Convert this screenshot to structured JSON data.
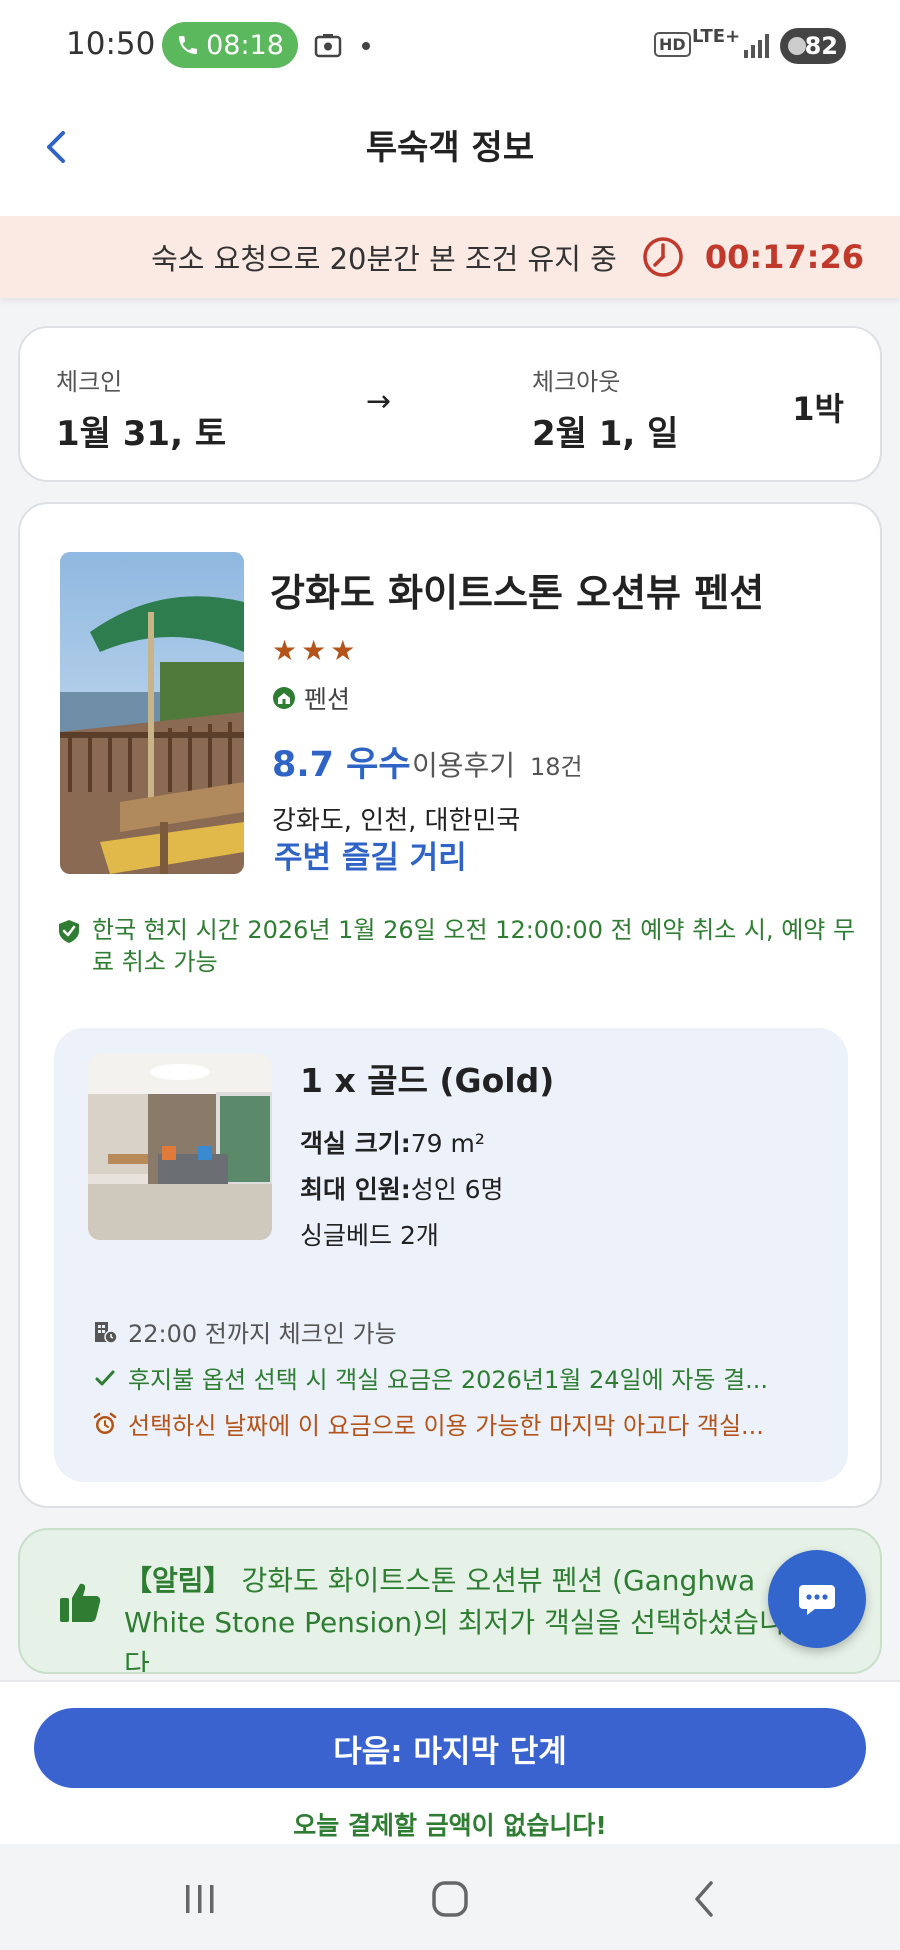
{
  "status_bar": {
    "time": "10:50",
    "call_duration": "08:18",
    "network_hd": "HD",
    "network_type": "LTE+",
    "battery": "82"
  },
  "header": {
    "title": "투숙객 정보"
  },
  "timer_banner": {
    "message": "숙소 요청으로 20분간 본 조건 유지 중",
    "countdown": "00:17:26",
    "color": "#c0392b"
  },
  "dates": {
    "checkin_label": "체크인",
    "checkin_value": "1월 31, 토",
    "checkout_label": "체크아웃",
    "checkout_value": "2월 1, 일",
    "arrow": "→",
    "nights": "1박"
  },
  "hotel": {
    "name": "강화도 화이트스톤 오션뷰 펜션",
    "stars": "★★★",
    "type": "펜션",
    "rating": "8.7 우수",
    "reviews_label": "이용후기",
    "reviews_count": "18건",
    "location": "강화도, 인천, 대한민국",
    "nearby_link": "주변 즐길 거리",
    "cancellation": "한국 현지 시간 2026년 1월 26일 오전 12:00:00 전 예약 취소 시, 예약 무료 취소 가능"
  },
  "room": {
    "name": "1 x 골드 (Gold)",
    "size_label": "객실 크기:",
    "size_value": "79 m²",
    "capacity_label": "최대 인원:",
    "capacity_value": "성인 6명",
    "beds": "싱글베드 2개",
    "feature_checkin": "22:00 전까지 체크인 가능",
    "feature_payment": "후지불 옵션 선택 시 객실 요금은 2026년1월 24일에 자동 결...",
    "feature_last_room": "선택하신 날짜에 이 요금으로 이용 가능한 마지막 아고다 객실..."
  },
  "notice": {
    "tag": "【알림】",
    "text": "강화도 화이트스톤 오션뷰 펜션 (Ganghwa White Stone Pension)의 최저가 객실을 선택하셨습니다"
  },
  "footer": {
    "next_button": "다음: 마지막 단계",
    "pay_note": "오늘 결제할 금액이 없습니다!"
  },
  "colors": {
    "accent_blue": "#3a63d0",
    "green": "#2e7d32",
    "orange": "#b4531a"
  }
}
